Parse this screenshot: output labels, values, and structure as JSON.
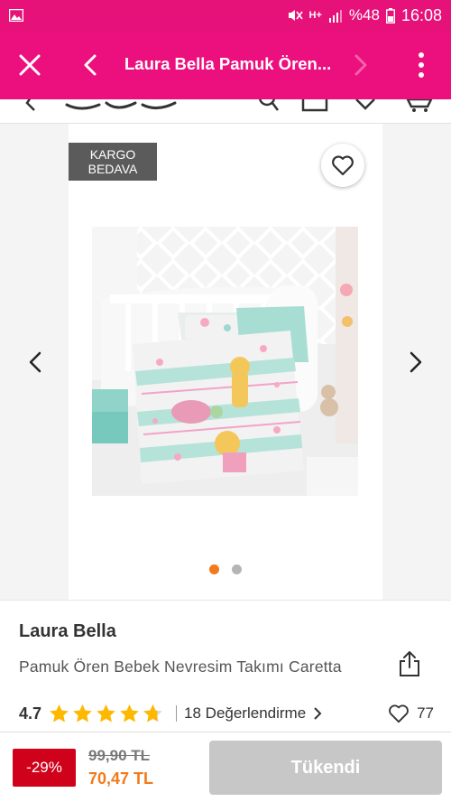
{
  "statusbar": {
    "battery_text": "%48",
    "time": "16:08",
    "network_text": "H+"
  },
  "toolbar": {
    "title": "Laura Bella Pamuk Ören...",
    "bg_color": "#ec0f7e"
  },
  "product": {
    "badge_line1": "KARGO",
    "badge_line2": "BEDAVA",
    "image_index": 0,
    "image_count": 2,
    "brand": "Laura Bella",
    "name": "Pamuk Ören Bebek Nevresim Takımı Caretta",
    "rating": "4.7",
    "rating_stars": 4.7,
    "reviews_text": "18 Değerlendirme",
    "likes": "77"
  },
  "pricing": {
    "discount": "-29%",
    "old_price": "99,90 TL",
    "new_price": "70,47 TL",
    "accent_color": "#f27a1a",
    "discount_color": "#d0021b"
  },
  "actions": {
    "soldout_label": "Tükendi"
  }
}
